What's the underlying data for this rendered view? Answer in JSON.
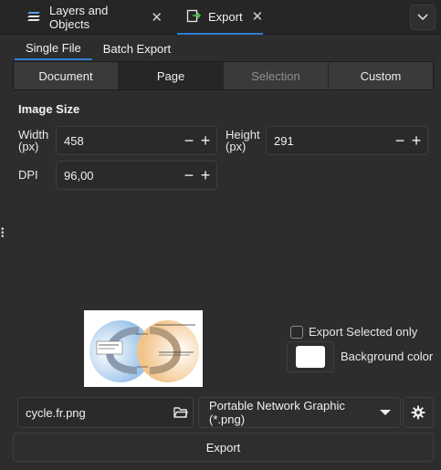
{
  "tabs": [
    {
      "label": "Layers and Objects"
    },
    {
      "label": "Export"
    }
  ],
  "subtabs": [
    {
      "label": "Single File",
      "active": true
    },
    {
      "label": "Batch Export",
      "active": false
    }
  ],
  "area_options": [
    {
      "label": "Document",
      "state": "normal"
    },
    {
      "label": "Page",
      "state": "active"
    },
    {
      "label": "Selection",
      "state": "disabled"
    },
    {
      "label": "Custom",
      "state": "normal"
    }
  ],
  "image_size": {
    "title": "Image Size",
    "width_label_1": "Width",
    "width_label_2": "(px)",
    "width_value": "458",
    "height_label_1": "Height",
    "height_label_2": "(px)",
    "height_value": "291",
    "dpi_label": "DPI",
    "dpi_value": "96,00"
  },
  "options": {
    "export_selected_only": "Export Selected only",
    "export_selected_checked": false,
    "background_color_label": "Background color",
    "background_color": "#ffffff"
  },
  "file": {
    "filename": "cycle.fr.png",
    "format": "Portable Network Graphic (*.png)"
  },
  "actions": {
    "export_label": "Export"
  },
  "colors": {
    "accent": "#2f7dd0"
  }
}
